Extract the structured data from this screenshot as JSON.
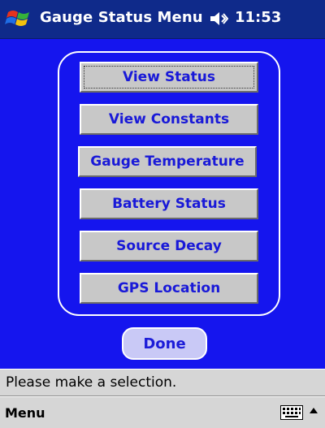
{
  "titlebar": {
    "title": "Gauge Status Menu",
    "time": "11:53",
    "start_icon": "windows-flag-icon",
    "speaker_icon": "speaker-muted-icon"
  },
  "menu": {
    "buttons": [
      {
        "label": "View Status",
        "selected": true
      },
      {
        "label": "View Constants"
      },
      {
        "label": "Gauge Temperature"
      },
      {
        "label": "Battery Status"
      },
      {
        "label": "Source Decay"
      },
      {
        "label": "GPS Location"
      }
    ]
  },
  "done_button": {
    "label": "Done"
  },
  "status_bar": {
    "text": "Please make a selection."
  },
  "command_bar": {
    "menu_label": "Menu",
    "keyboard_icon": "keyboard-icon",
    "sip_arrow": "up-arrow-icon"
  },
  "colors": {
    "background": "#1515ee",
    "titlebar": "#0f2a8a",
    "button_face": "#c8c8c8",
    "button_text": "#1919d8",
    "done_face": "#c9c9f6"
  }
}
